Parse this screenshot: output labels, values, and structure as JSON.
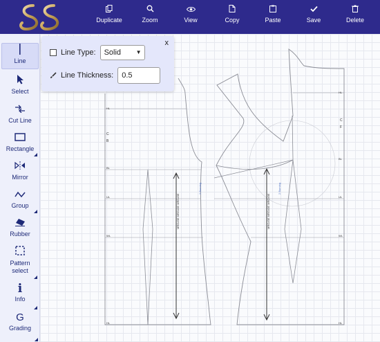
{
  "toolbar": {
    "items": [
      {
        "label": "Duplicate",
        "icon": "duplicate-icon"
      },
      {
        "label": "Zoom",
        "icon": "zoom-icon"
      },
      {
        "label": "View",
        "icon": "eye-icon"
      },
      {
        "label": "Copy",
        "icon": "copy-icon"
      },
      {
        "label": "Paste",
        "icon": "paste-icon"
      },
      {
        "label": "Save",
        "icon": "save-icon"
      },
      {
        "label": "Delete",
        "icon": "delete-icon"
      }
    ]
  },
  "sidebar": {
    "items": [
      {
        "label": "Line",
        "icon": "line-icon",
        "active": true
      },
      {
        "label": "Select",
        "icon": "cursor-icon"
      },
      {
        "label": "Cut Line",
        "icon": "cut-line-icon"
      },
      {
        "label": "Rectangle",
        "icon": "rectangle-icon"
      },
      {
        "label": "Mirror",
        "icon": "mirror-icon"
      },
      {
        "label": "Group",
        "icon": "group-icon"
      },
      {
        "label": "Rubber",
        "icon": "eraser-icon"
      },
      {
        "label": "Pattern select",
        "icon": "pattern-select-icon"
      },
      {
        "label": "Info",
        "icon": "info-icon"
      },
      {
        "label": "Grading",
        "icon": "grading-icon"
      }
    ]
  },
  "panel": {
    "line_type_label": "Line Type:",
    "line_type_value": "Solid",
    "line_thickness_label": "Line Thickness:",
    "line_thickness_value": "0.5",
    "close_label": "x"
  },
  "canvas": {
    "labels": {
      "hl": "HL",
      "c": "C",
      "b": "B",
      "bl": "BL",
      "ul": "UL",
      "wl": "WL",
      "f": "F"
    },
    "grain_text": "MRG#3E MRG#3E MRG#3E",
    "blue_text": "2 Burning"
  },
  "colors": {
    "topbar": "#2e2a8c",
    "sidebar": "#eef0fb",
    "accent": "#1e2a78",
    "panel": "#e4e7fb"
  }
}
